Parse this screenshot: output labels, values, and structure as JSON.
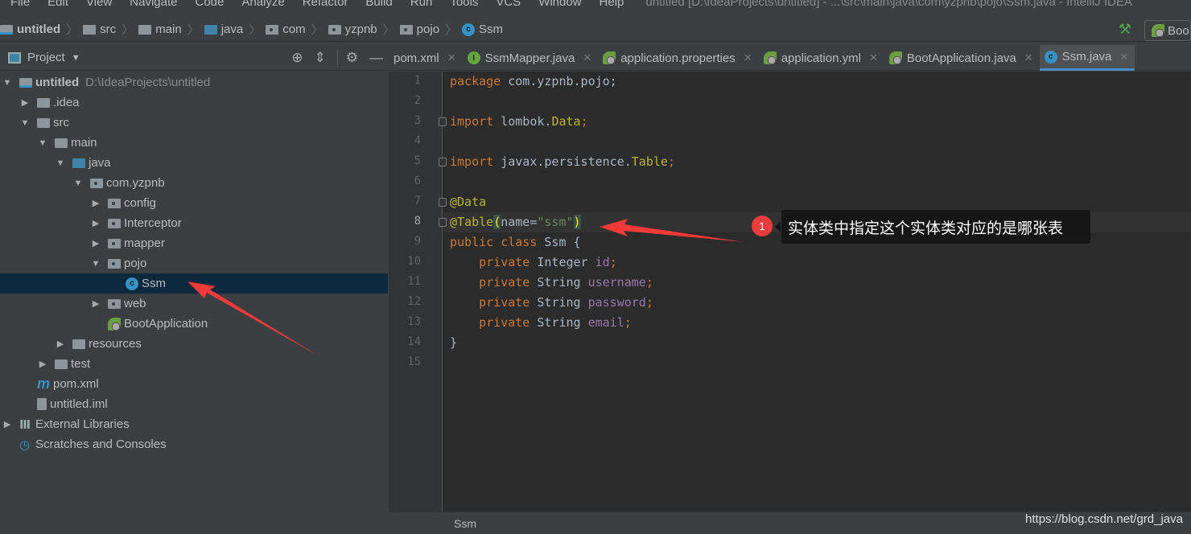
{
  "menu": {
    "items": [
      "File",
      "Edit",
      "View",
      "Navigate",
      "Code",
      "Analyze",
      "Refactor",
      "Build",
      "Run",
      "Tools",
      "VCS",
      "Window",
      "Help"
    ],
    "window_title": "untitled [D:\\IdeaProjects\\untitled] - ...\\src\\main\\java\\com\\yzpnb\\pojo\\Ssm.java - IntelliJ IDEA"
  },
  "breadcrumb": [
    {
      "label": "untitled",
      "icon": "module-folder-icon"
    },
    {
      "label": "src",
      "icon": "folder-icon"
    },
    {
      "label": "main",
      "icon": "folder-icon"
    },
    {
      "label": "java",
      "icon": "source-folder-icon"
    },
    {
      "label": "com",
      "icon": "package-icon"
    },
    {
      "label": "yzpnb",
      "icon": "package-icon"
    },
    {
      "label": "pojo",
      "icon": "package-icon"
    },
    {
      "label": "Ssm",
      "icon": "class-icon"
    }
  ],
  "run_config": {
    "label": "Boo"
  },
  "project_panel": {
    "title": "Project"
  },
  "tabs": [
    {
      "label": "pom.xml",
      "icon": "none"
    },
    {
      "label": "SsmMapper.java",
      "icon": "interface-icon"
    },
    {
      "label": "application.properties",
      "icon": "spring-icon"
    },
    {
      "label": "application.yml",
      "icon": "spring-icon"
    },
    {
      "label": "BootApplication.java",
      "icon": "spring-boot-class-icon"
    },
    {
      "label": "Ssm.java",
      "icon": "class-icon",
      "active": true
    }
  ],
  "tree": [
    {
      "label": "untitled",
      "path": "D:\\IdeaProjects\\untitled",
      "level": 0,
      "expand": "open",
      "icon": "module",
      "bold": true
    },
    {
      "label": ".idea",
      "level": 1,
      "expand": "closed",
      "icon": "folder"
    },
    {
      "label": "src",
      "level": 1,
      "expand": "open",
      "icon": "folder"
    },
    {
      "label": "main",
      "level": 2,
      "expand": "open",
      "icon": "folder"
    },
    {
      "label": "java",
      "level": 3,
      "expand": "open",
      "icon": "source"
    },
    {
      "label": "com.yzpnb",
      "level": 4,
      "expand": "open",
      "icon": "package"
    },
    {
      "label": "config",
      "level": 5,
      "expand": "closed",
      "icon": "package"
    },
    {
      "label": "Interceptor",
      "level": 5,
      "expand": "closed",
      "icon": "package"
    },
    {
      "label": "mapper",
      "level": 5,
      "expand": "closed",
      "icon": "package"
    },
    {
      "label": "pojo",
      "level": 5,
      "expand": "open",
      "icon": "package"
    },
    {
      "label": "Ssm",
      "level": 6,
      "expand": "none",
      "icon": "class",
      "selected": true
    },
    {
      "label": "web",
      "level": 5,
      "expand": "closed",
      "icon": "package"
    },
    {
      "label": "BootApplication",
      "level": 5,
      "expand": "none",
      "icon": "spring"
    },
    {
      "label": "resources",
      "level": 3,
      "expand": "closed",
      "icon": "folder"
    },
    {
      "label": "test",
      "level": 2,
      "expand": "closed",
      "icon": "folder"
    },
    {
      "label": "pom.xml",
      "level": 1,
      "expand": "none",
      "icon": "maven"
    },
    {
      "label": "untitled.iml",
      "level": 1,
      "expand": "none",
      "icon": "file"
    },
    {
      "label": "External Libraries",
      "level": 0,
      "expand": "closed",
      "icon": "libs"
    },
    {
      "label": "Scratches and Consoles",
      "level": 0,
      "expand": "none",
      "icon": "scratch"
    }
  ],
  "code": {
    "line_numbers": [
      "1",
      "2",
      "3",
      "4",
      "5",
      "6",
      "7",
      "8",
      "9",
      "10",
      "11",
      "12",
      "13",
      "14",
      "15"
    ],
    "current_line": 8,
    "lines": [
      [
        [
          "package ",
          "kw"
        ],
        [
          "com.yzpnb.pojo;",
          "pl"
        ]
      ],
      [],
      [
        [
          "import ",
          "kw"
        ],
        [
          "lombok.",
          "pl"
        ],
        [
          "Data",
          "ann"
        ],
        [
          ";",
          "kw"
        ]
      ],
      [],
      [
        [
          "import ",
          "kw"
        ],
        [
          "javax.persistence.",
          "pl"
        ],
        [
          "Table",
          "ann"
        ],
        [
          ";",
          "kw"
        ]
      ],
      [],
      [
        [
          "@Data",
          "ann"
        ]
      ],
      [
        [
          "@Table",
          "ann"
        ],
        [
          "(",
          "br"
        ],
        [
          "name=",
          "pl"
        ],
        [
          "\"ssm\"",
          "str"
        ],
        [
          ")",
          "br"
        ]
      ],
      [
        [
          "public class ",
          "kw"
        ],
        [
          "Ssm {",
          "pl"
        ]
      ],
      [
        [
          "    private ",
          "kw"
        ],
        [
          "Integer ",
          "pl"
        ],
        [
          "id",
          "fld"
        ],
        [
          ";",
          "kw"
        ]
      ],
      [
        [
          "    private ",
          "kw"
        ],
        [
          "String ",
          "pl"
        ],
        [
          "username",
          "fld"
        ],
        [
          ";",
          "kw"
        ]
      ],
      [
        [
          "    private ",
          "kw"
        ],
        [
          "String ",
          "pl"
        ],
        [
          "password",
          "fld"
        ],
        [
          ";",
          "kw"
        ]
      ],
      [
        [
          "    private ",
          "kw"
        ],
        [
          "String ",
          "pl"
        ],
        [
          "email",
          "fld"
        ],
        [
          ";",
          "kw"
        ]
      ],
      [
        [
          "}",
          "pl"
        ]
      ],
      []
    ]
  },
  "annotation": {
    "badge": "1",
    "text": "实体类中指定这个实体类对应的是哪张表",
    "color": "#e83b3b"
  },
  "status": {
    "class_name": "Ssm",
    "watermark": "https://blog.csdn.net/grd_java"
  }
}
